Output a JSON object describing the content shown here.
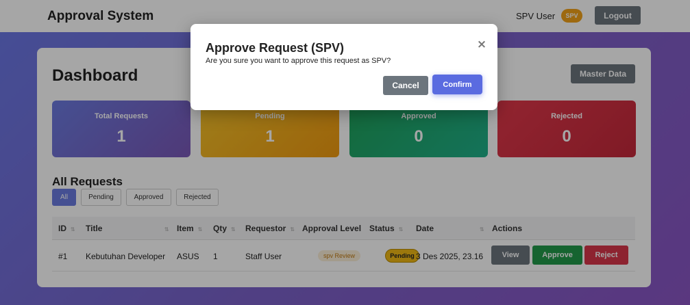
{
  "header": {
    "brand": "Approval System",
    "user_name": "SPV User",
    "role_badge": "SPV",
    "logout_label": "Logout"
  },
  "dashboard": {
    "title": "Dashboard",
    "master_data_label": "Master Data",
    "stats": {
      "total": {
        "label": "Total Requests",
        "value": "1"
      },
      "pending": {
        "label": "Pending",
        "value": "1"
      },
      "approved": {
        "label": "Approved",
        "value": "0"
      },
      "rejected": {
        "label": "Rejected",
        "value": "0"
      }
    }
  },
  "requests": {
    "title": "All Requests",
    "filters": [
      "All",
      "Pending",
      "Approved",
      "Rejected"
    ],
    "active_filter": "All",
    "columns": [
      "ID",
      "Title",
      "Item",
      "Qty",
      "Requestor",
      "Approval Level",
      "Status",
      "Date",
      "Actions"
    ],
    "rows": [
      {
        "id": "#1",
        "title": "Kebutuhan Developer",
        "item": "ASUS",
        "qty": "1",
        "requestor": "Staff User",
        "approval_level": "spv Review",
        "status": "Pending",
        "date": "3 Des 2025, 23.16",
        "actions": {
          "view": "View",
          "approve": "Approve",
          "reject": "Reject"
        }
      }
    ]
  },
  "modal": {
    "title": "Approve Request (SPV)",
    "message": "Are you sure you want to approve this request as SPV?",
    "close_glyph": "×",
    "cancel_label": "Cancel",
    "confirm_label": "Confirm"
  },
  "colors": {
    "accent": "#5a6be0",
    "pending": "#f0b814",
    "approved": "#229a4a",
    "rejected": "#d9364a",
    "neutral_button": "#6c757d"
  }
}
